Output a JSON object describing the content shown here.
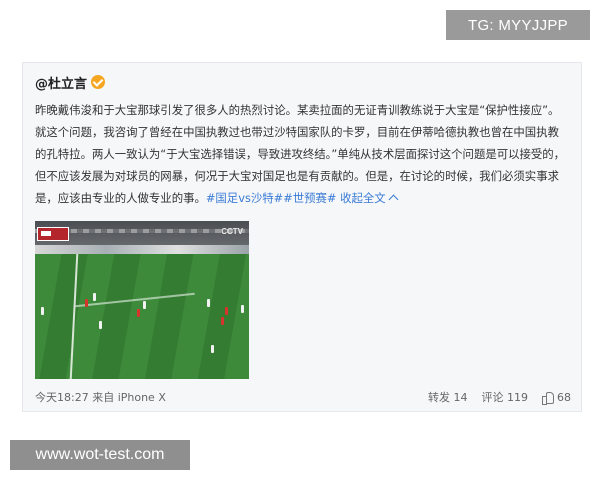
{
  "watermarks": {
    "tg": "TG: MYYJJPP",
    "site": "www.wot-test.com"
  },
  "post": {
    "author": "@杜立言",
    "text_parts": [
      {
        "kind": "text",
        "value": "昨晚戴伟浚和于大宝那球引发了很多人的热烈讨论。某卖拉面的无证青训教练说于大宝是“保护性接应”。就这个问题，我咨询了曾经在中国执教过也带过沙特国家队的卡罗，目前在伊蒂哈德执教也曾在中国执教的孔特拉。两人一致认为“于大宝选择错误，导致进攻终结。”单纯从技术层面探讨这个问题是可以接受的，但不应该发展为对球员的网暴，何况于大宝对国足也是有贡献的。但是，在讨论的时候，我们必须实事求是，应该由专业的人做专业的事。"
      },
      {
        "kind": "hashtag",
        "value": "#国足vs沙特##世预赛#"
      },
      {
        "kind": "expand",
        "value": " 收起全文"
      }
    ],
    "video": {
      "logo": "CCTV"
    },
    "meta": "今天18:27 来自 iPhone X",
    "stats": {
      "repost_label": "转发",
      "repost_count": "14",
      "comment_label": "评论",
      "comment_count": "119",
      "like_count": "68"
    }
  },
  "colors": {
    "link": "#3a7bd5",
    "verified": "#f5a623"
  }
}
